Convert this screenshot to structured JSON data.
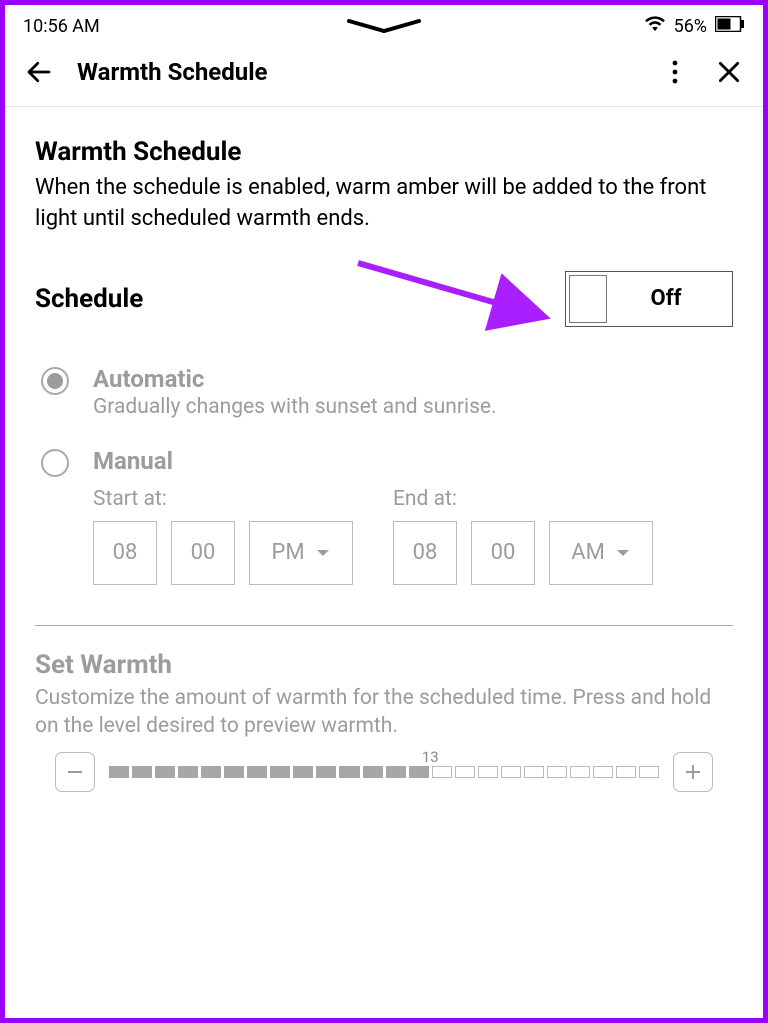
{
  "statusbar": {
    "time": "10:56 AM",
    "battery_pct": "56%"
  },
  "appbar": {
    "title": "Warmth Schedule"
  },
  "header": {
    "title": "Warmth Schedule",
    "desc": "When the schedule is enabled, warm amber will be added to the front light until scheduled warmth ends."
  },
  "schedule": {
    "label": "Schedule",
    "toggle_state": "Off"
  },
  "options": {
    "automatic": {
      "title": "Automatic",
      "desc": "Gradually changes with sunset and sunrise."
    },
    "manual": {
      "title": "Manual",
      "start_label": "Start at:",
      "end_label": "End at:",
      "start_hour": "08",
      "start_min": "00",
      "start_ampm": "PM",
      "end_hour": "08",
      "end_min": "00",
      "end_ampm": "AM"
    }
  },
  "warmth": {
    "title": "Set Warmth",
    "desc": "Customize the amount of warmth for the scheduled time. Press and hold on the level desired to preview warmth.",
    "value": "13",
    "filled": 14,
    "total": 24
  }
}
